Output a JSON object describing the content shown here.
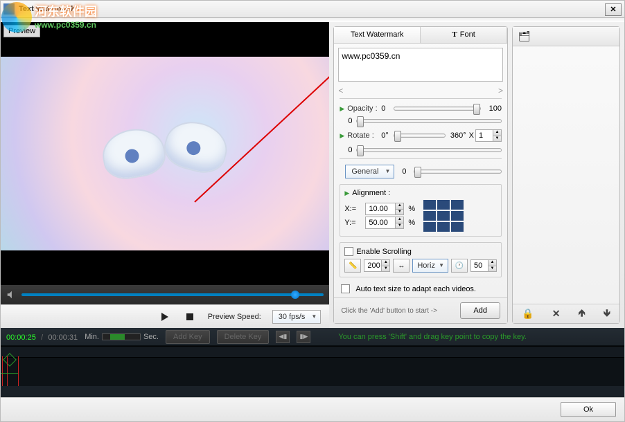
{
  "window": {
    "title": "Text Watermark"
  },
  "overlay": {
    "cn": "河东软件园",
    "url": "www.pc0359.cn"
  },
  "preview": {
    "button": "Preview",
    "speed_label": "Preview Speed:",
    "fps": "30 fps/s"
  },
  "tabs": {
    "text": "Text Watermark",
    "font": "T Font"
  },
  "watermark_text": "www.pc0359.cn",
  "opacity": {
    "label": "Opacity :",
    "min": "0",
    "max": "100",
    "sub": "0"
  },
  "rotate": {
    "label": "Rotate  :",
    "min": "0°",
    "max": "360°",
    "xlabel": "X",
    "xval": "1",
    "sub": "0"
  },
  "general": {
    "label": "General",
    "val": "0"
  },
  "alignment": {
    "title": "Alignment :",
    "xlabel": "X:=",
    "xval": "10.00",
    "ylabel": "Y:=",
    "yval": "50.00",
    "pct": "%"
  },
  "scrolling": {
    "enable": "Enable Scrolling",
    "width": "200",
    "dir": "Horiz",
    "delay": "50"
  },
  "autosize": "Auto text size to adapt each videos.",
  "add": {
    "hint": "Click the 'Add' button to start ->",
    "btn": "Add"
  },
  "timeline": {
    "current": "00:00:25",
    "total": "00:00:31",
    "min": "Min.",
    "sec": "Sec.",
    "addkey": "Add Key",
    "delkey": "Delete Key",
    "hint": "You can press 'Shift' and drag key point to copy the key."
  },
  "footer": {
    "ok": "Ok"
  }
}
